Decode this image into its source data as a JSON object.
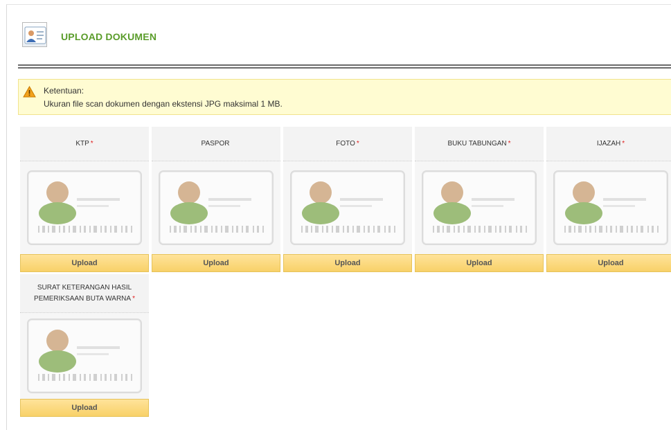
{
  "header": {
    "title": "UPLOAD DOKUMEN",
    "icon": "id-card-icon"
  },
  "notice": {
    "icon": "warning-icon",
    "title": "Ketentuan:",
    "text": "Ukuran file scan dokumen dengan ekstensi JPG maksimal 1 MB."
  },
  "documents": [
    {
      "label": "KTP",
      "required": "*",
      "button": "Upload"
    },
    {
      "label": "PASPOR",
      "required": "",
      "button": "Upload"
    },
    {
      "label": "FOTO",
      "required": "*",
      "button": "Upload"
    },
    {
      "label": "BUKU TABUNGAN",
      "required": "*",
      "button": "Upload"
    },
    {
      "label": "IJAZAH",
      "required": "*",
      "button": "Upload"
    },
    {
      "label_line1": "SURAT KETERANGAN HASIL",
      "label_line2": "PEMERIKSAAN BUTA WARNA",
      "required": "*",
      "button": "Upload"
    }
  ],
  "colors": {
    "title_green": "#5a9c2a",
    "notice_bg": "#fffcd2",
    "button_bg": "#f8d169",
    "required_red": "#e0201f"
  }
}
